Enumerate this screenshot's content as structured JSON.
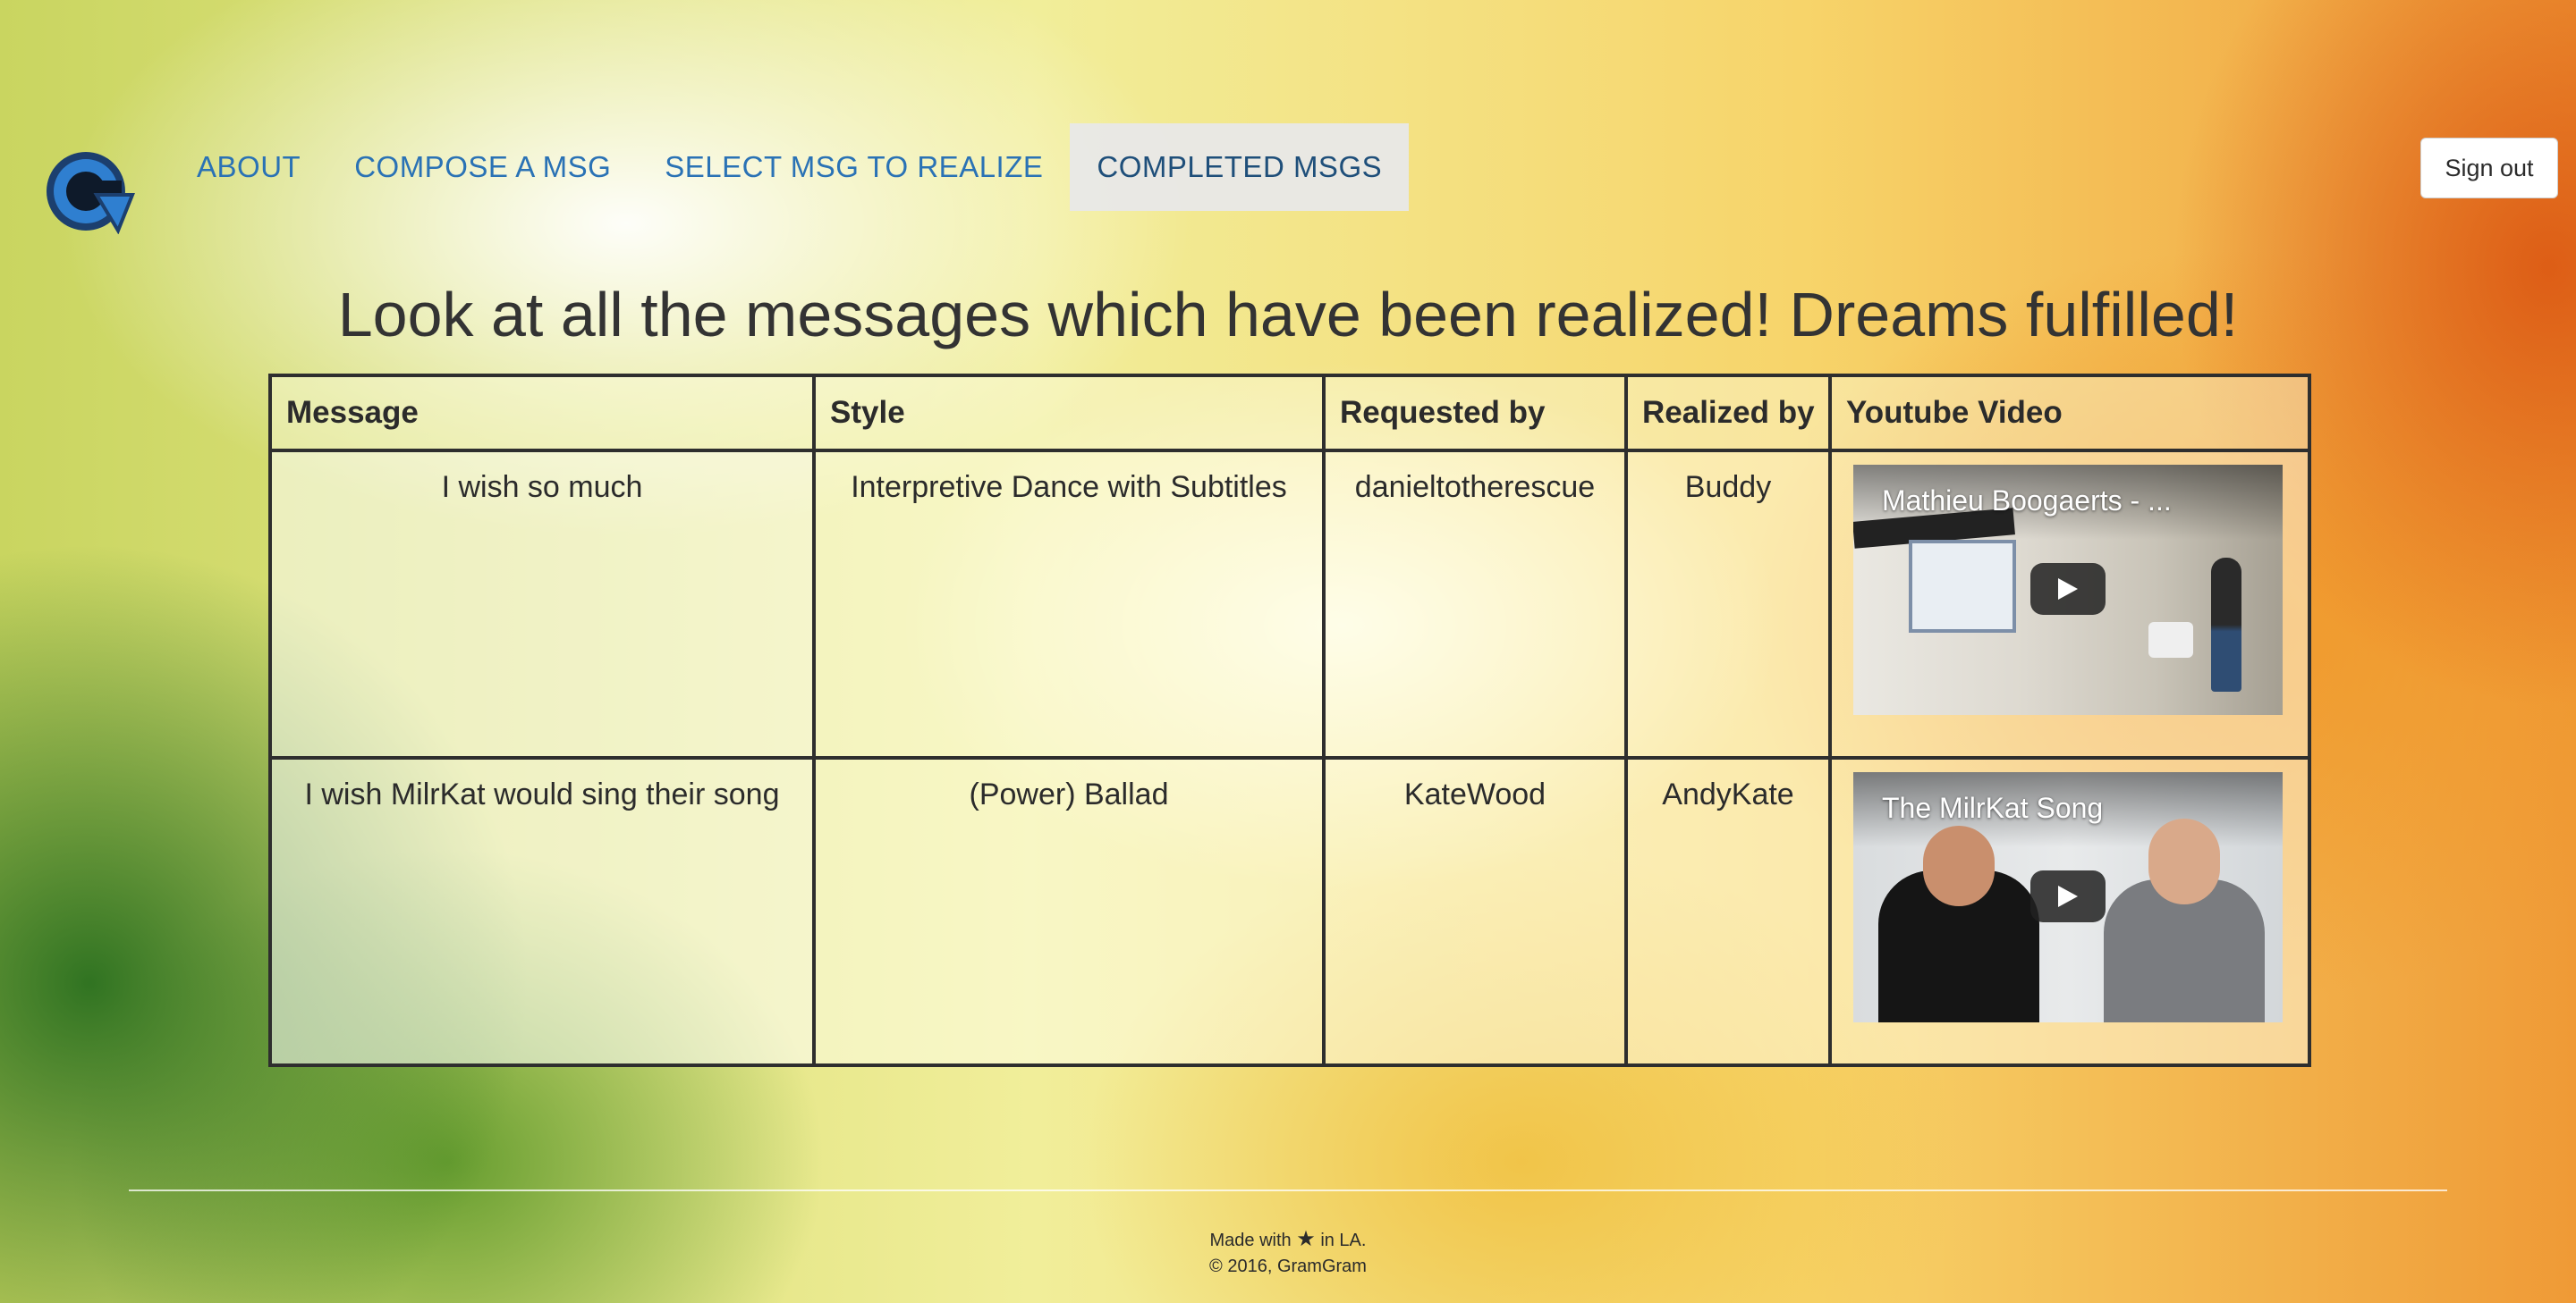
{
  "nav": {
    "items": [
      {
        "label": "ABOUT",
        "active": false
      },
      {
        "label": "COMPOSE A MSG",
        "active": false
      },
      {
        "label": "SELECT MSG TO REALIZE",
        "active": false
      },
      {
        "label": "COMPLETED MSGS",
        "active": true
      }
    ],
    "sign_out": "Sign out",
    "logo_letter": "G"
  },
  "page": {
    "heading": "Look at all the messages which have been realized! Dreams fulfilled!"
  },
  "table": {
    "headers": [
      "Message",
      "Style",
      "Requested by",
      "Realized by",
      "Youtube Video"
    ],
    "rows": [
      {
        "message": "I wish so much",
        "style": "Interpretive Dance with Subtitles",
        "requested_by": "danieltotherescue",
        "realized_by": "Buddy",
        "video_title": "Mathieu Boogaerts - ..."
      },
      {
        "message": "I wish MilrKat would sing their song",
        "style": "(Power) Ballad",
        "requested_by": "KateWood",
        "realized_by": "AndyKate",
        "video_title": "The MilrKat Song"
      }
    ]
  },
  "footer": {
    "made_prefix": "Made with",
    "made_star": "★",
    "made_suffix": "in LA.",
    "copyright": "© 2016, GramGram"
  },
  "colors": {
    "nav_link": "#2a72b5",
    "nav_active_bg": "#e8e8e8",
    "table_border": "#2e2e2e",
    "logo_blue": "#1f5fa8"
  }
}
